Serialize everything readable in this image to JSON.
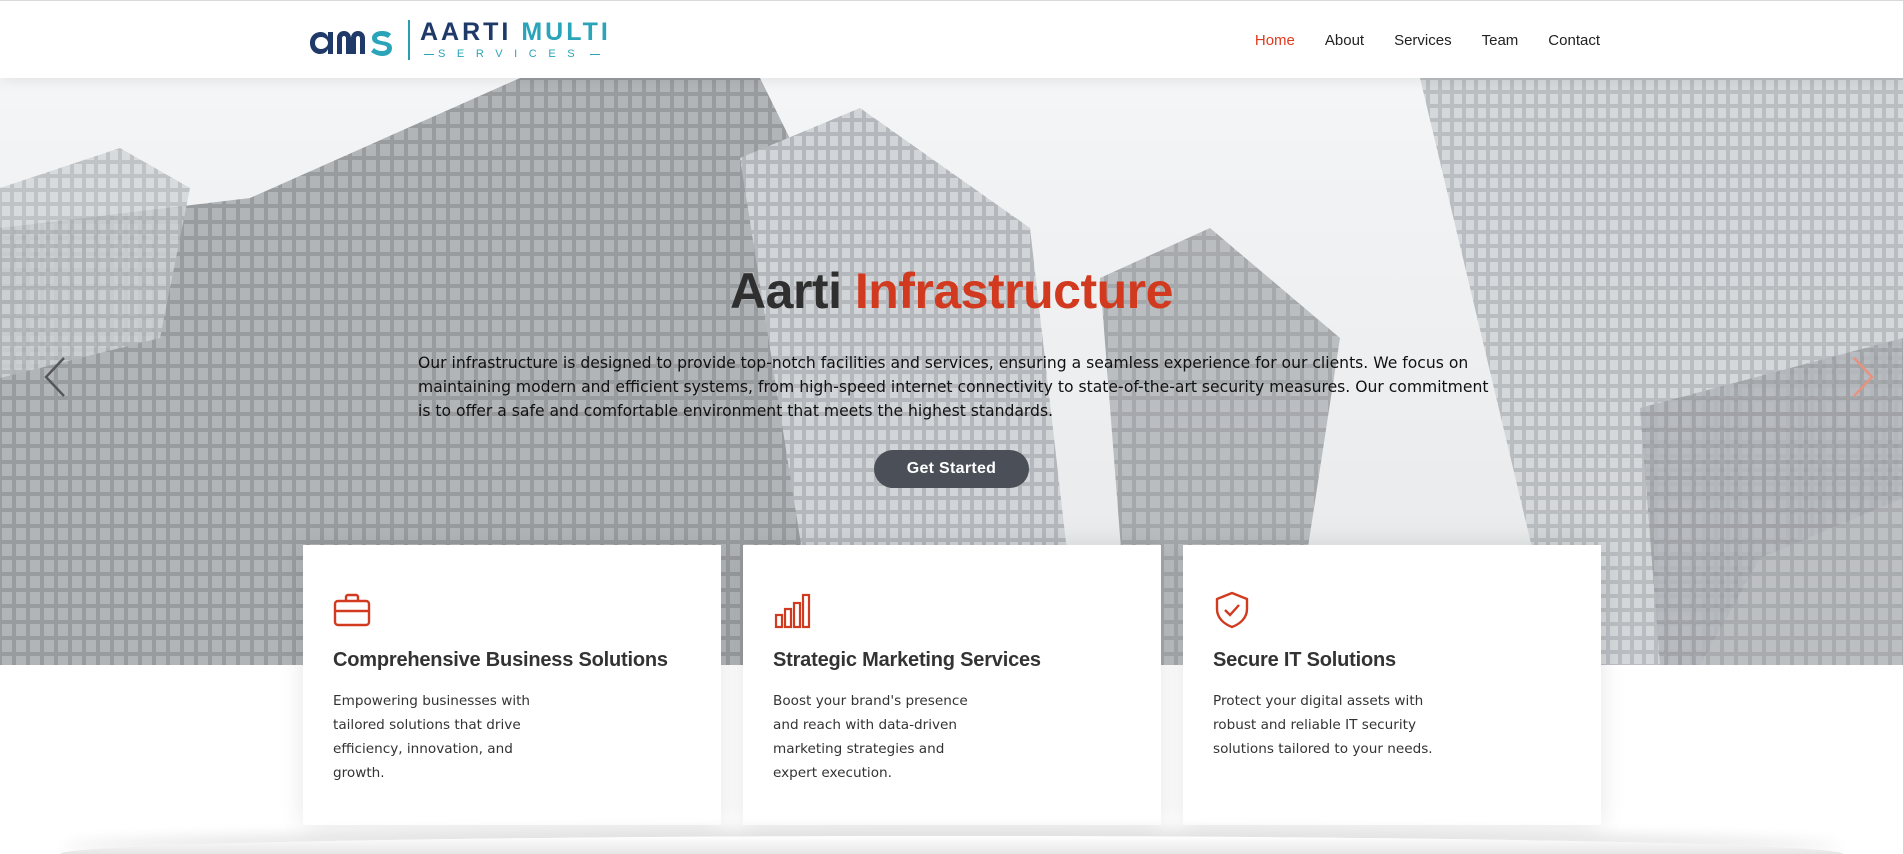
{
  "brand": {
    "logo_title_main": "AARTI",
    "logo_title_accent": "MULTI",
    "logo_subtitle": "SERVICES",
    "colors": {
      "navy": "#1f3a68",
      "teal": "#2aa4b8"
    }
  },
  "nav": {
    "items": [
      {
        "label": "Home",
        "active": true
      },
      {
        "label": "About",
        "active": false
      },
      {
        "label": "Services",
        "active": false
      },
      {
        "label": "Team",
        "active": false
      },
      {
        "label": "Contact",
        "active": false
      }
    ],
    "active_color": "#e03a1e"
  },
  "hero": {
    "title_main": "Aarti",
    "title_accent": "Infrastructure",
    "description": "Our infrastructure is designed to provide top-notch facilities and services, ensuring a seamless experience for our clients. We focus on maintaining modern and efficient systems, from high-speed internet connectivity to state-of-the-art security measures. Our commitment is to offer a safe and comfortable environment that meets the highest standards.",
    "cta_label": "Get Started",
    "prev_icon": "chevron-left-icon",
    "next_icon": "chevron-right-icon",
    "accent_color": "#d23a20"
  },
  "cards": [
    {
      "icon": "briefcase-icon",
      "title": "Comprehensive Business Solutions",
      "text": "Empowering businesses with tailored solutions that drive efficiency, innovation, and growth."
    },
    {
      "icon": "bar-chart-icon",
      "title": "Strategic Marketing Services",
      "text": "Boost your brand's presence and reach with data-driven marketing strategies and expert execution."
    },
    {
      "icon": "shield-check-icon",
      "title": "Secure IT Solutions",
      "text": "Protect your digital assets with robust and reliable IT security solutions tailored to your needs."
    }
  ]
}
